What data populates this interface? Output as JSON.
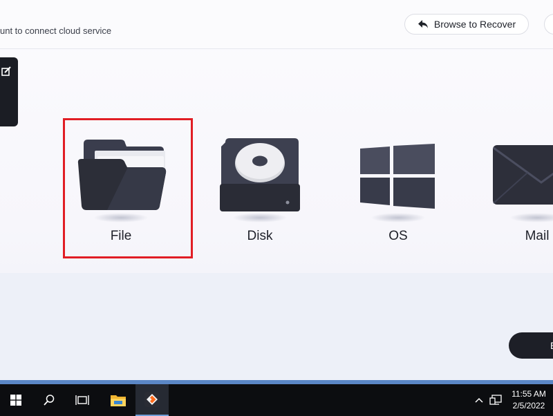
{
  "header": {
    "cloud_prompt": "unt to connect cloud service",
    "browse_label": "Browse to Recover"
  },
  "tiles": [
    {
      "label": "File",
      "icon": "folder-icon"
    },
    {
      "label": "Disk",
      "icon": "disk-icon"
    },
    {
      "label": "OS",
      "icon": "windows-icon"
    },
    {
      "label": "Mail",
      "icon": "mail-icon"
    }
  ],
  "next_button": {
    "label": "E"
  },
  "taskbar": {
    "time": "11:55 AM",
    "date": "2/5/2022"
  },
  "colors": {
    "highlight": "#e11d24",
    "dark": "#1d1f27",
    "taskbar_accent": "#5b87c6"
  }
}
